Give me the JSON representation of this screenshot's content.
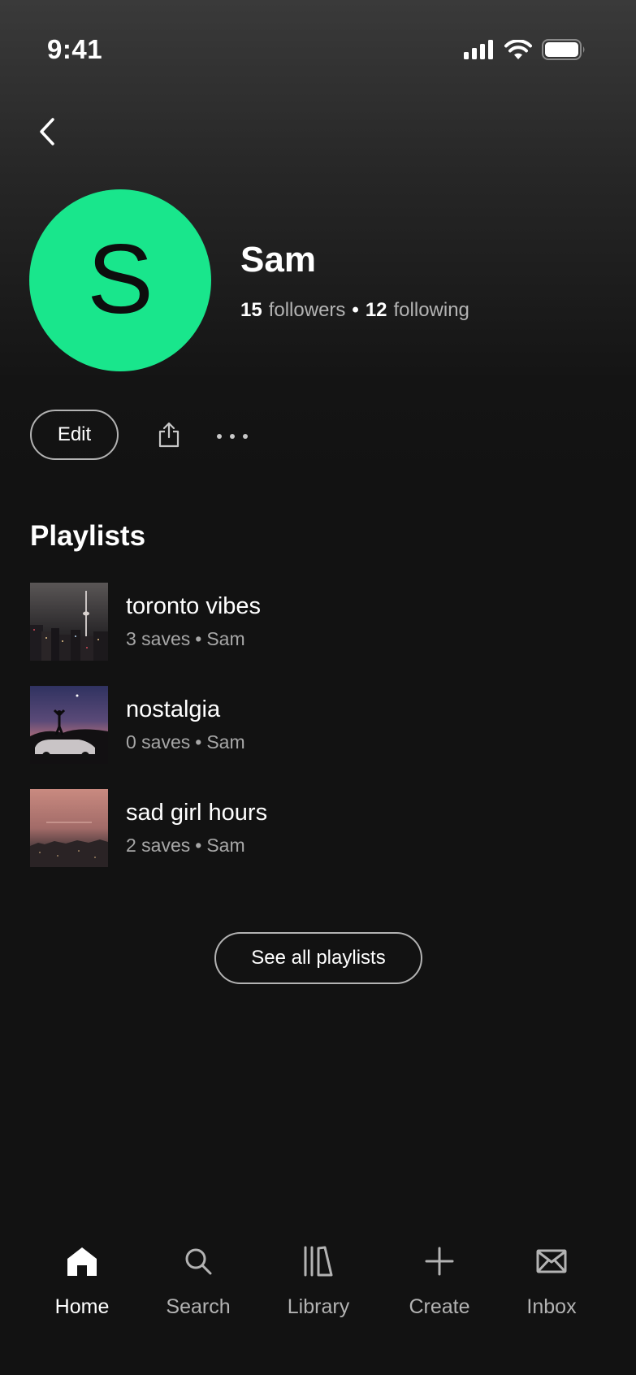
{
  "status_bar": {
    "time": "9:41",
    "icons": [
      "cellular-signal-icon",
      "wifi-icon",
      "battery-icon"
    ]
  },
  "header": {
    "back_icon": "chevron-left-icon"
  },
  "profile": {
    "avatar_letter": "S",
    "avatar_color": "#19e68c",
    "name": "Sam",
    "followers_count": "15",
    "followers_label": "followers",
    "separator": "•",
    "following_count": "12",
    "following_label": "following"
  },
  "actions": {
    "edit_label": "Edit",
    "share_icon": "share-icon",
    "more_icon": "more-icon"
  },
  "playlists": {
    "title": "Playlists",
    "items": [
      {
        "title": "toronto vibes",
        "saves": "3 saves",
        "separator": "•",
        "owner": "Sam"
      },
      {
        "title": "nostalgia",
        "saves": "0 saves",
        "separator": "•",
        "owner": "Sam"
      },
      {
        "title": "sad girl hours",
        "saves": "2 saves",
        "separator": "•",
        "owner": "Sam"
      }
    ],
    "see_all_label": "See all playlists"
  },
  "bottom_nav": {
    "items": [
      {
        "label": "Home",
        "icon": "home-icon",
        "active": true
      },
      {
        "label": "Search",
        "icon": "search-icon",
        "active": false
      },
      {
        "label": "Library",
        "icon": "library-icon",
        "active": false
      },
      {
        "label": "Create",
        "icon": "plus-icon",
        "active": false
      },
      {
        "label": "Inbox",
        "icon": "envelope-icon",
        "active": false
      }
    ]
  },
  "colors": {
    "background": "#121212",
    "accent": "#19e68c",
    "text_primary": "#ffffff",
    "text_secondary": "#b3b3b3"
  }
}
